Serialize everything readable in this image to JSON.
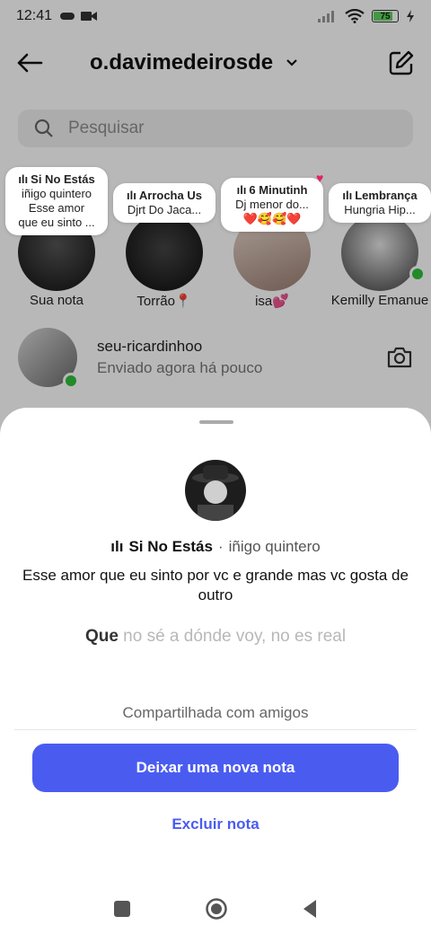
{
  "status_bar": {
    "time": "12:41",
    "battery": "75"
  },
  "header": {
    "username": "o.davimedeirosde"
  },
  "search": {
    "placeholder": "Pesquisar"
  },
  "notes": [
    {
      "song": "Si No Estás",
      "line1": "iñigo quintero",
      "line2": "Esse amor",
      "line3": "que eu sinto ...",
      "name": "Sua nota"
    },
    {
      "song": "Arrocha Us",
      "line1": "Djrt Do Jaca...",
      "name": "Torrão📍"
    },
    {
      "song": "6 Minutinh",
      "line1": "Dj menor do...",
      "line2": "❤️🥰🥰❤️",
      "name": "isa💕"
    },
    {
      "song": "Lembrança",
      "line1": "Hungria Hip...",
      "name": "Kemilly Emanue"
    }
  ],
  "chat": {
    "name": "seu-ricardinhoo",
    "message": "Enviado agora há pouco"
  },
  "sheet": {
    "song_title": "Si No Estás",
    "separator": "·",
    "artist": "iñigo quintero",
    "note_text": "Esse amor que eu sinto por vc e grande mas vc gosta de outro",
    "lyric_current": "Que",
    "lyric_next": "no sé a dónde voy, no es real",
    "shared_label": "Compartilhada com amigos",
    "new_note_button": "Deixar uma nova nota",
    "delete_button": "Excluir nota"
  },
  "colors": {
    "primary_button": "#4a5cf0",
    "online_dot": "#2fbf3a"
  }
}
